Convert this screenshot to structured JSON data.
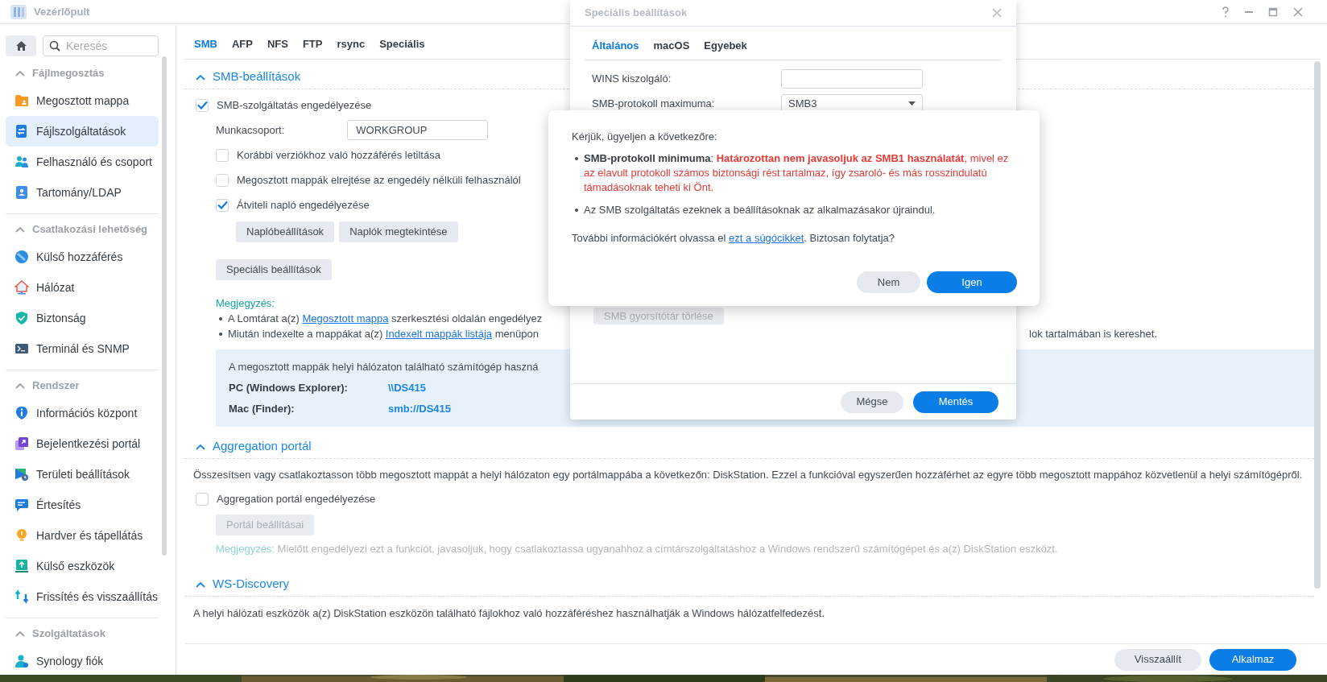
{
  "window": {
    "title": "Vezérlőpult"
  },
  "sidebar": {
    "search": {
      "placeholder": "Keresés"
    },
    "groups": [
      {
        "title": "Fájlmegosztás",
        "expanded": true,
        "items": [
          {
            "label": "Megosztott mappa",
            "selected": false
          },
          {
            "label": "Fájlszolgáltatások",
            "selected": true
          },
          {
            "label": "Felhasználó és csoport",
            "selected": false
          },
          {
            "label": "Tartomány/LDAP",
            "selected": false
          }
        ]
      },
      {
        "title": "Csatlakozási lehetőség",
        "expanded": true,
        "items": [
          {
            "label": "Külső hozzáférés",
            "selected": false
          },
          {
            "label": "Hálózat",
            "selected": false
          },
          {
            "label": "Biztonság",
            "selected": false
          },
          {
            "label": "Terminál és SNMP",
            "selected": false
          }
        ]
      },
      {
        "title": "Rendszer",
        "expanded": true,
        "items": [
          {
            "label": "Információs központ",
            "selected": false
          },
          {
            "label": "Bejelentkezési portál",
            "selected": false
          },
          {
            "label": "Területi beállítások",
            "selected": false
          },
          {
            "label": "Értesítés",
            "selected": false
          },
          {
            "label": "Hardver és tápellátás",
            "selected": false
          },
          {
            "label": "Külső eszközök",
            "selected": false
          },
          {
            "label": "Frissítés és visszaállítás",
            "selected": false
          }
        ]
      },
      {
        "title": "Szolgáltatások",
        "expanded": true,
        "items": [
          {
            "label": "Synology fiók",
            "selected": false
          }
        ]
      }
    ]
  },
  "tabs": [
    {
      "label": "SMB",
      "selected": true
    },
    {
      "label": "AFP",
      "selected": false
    },
    {
      "label": "NFS",
      "selected": false
    },
    {
      "label": "FTP",
      "selected": false
    },
    {
      "label": "rsync",
      "selected": false
    },
    {
      "label": "Speciális",
      "selected": false
    }
  ],
  "smb_section": {
    "title": "SMB-beállítások",
    "expanded": true,
    "enable": {
      "label": "SMB-szolgáltatás engedélyezése",
      "checked": true
    },
    "workgroup": {
      "label": "Munkacsoport:",
      "value": "WORKGROUP"
    },
    "options": [
      {
        "label": "Korábbi verziókhoz való hozzáférés letiltása",
        "checked": false
      },
      {
        "label": "Megosztott mappák elrejtése az engedély nélküli felhasználól",
        "checked": false
      },
      {
        "label": "Átviteli napló engedélyezése",
        "checked": true
      }
    ],
    "log_buttons": [
      {
        "label": "Naplóbeállítások",
        "disabled": false
      },
      {
        "label": "Naplók megtekintése",
        "disabled": false
      }
    ],
    "advanced_button": {
      "label": "Speciális beállítások",
      "disabled": false
    },
    "note": {
      "title": "Megjegyzés:",
      "items": [
        {
          "parts": [
            {
              "text": "A Lomtárat a(z) ",
              "link": false
            },
            {
              "text": "Megosztott mappa",
              "link": true
            },
            {
              "text": " szerkesztési oldalán engedélyez",
              "link": false
            }
          ]
        },
        {
          "parts": [
            {
              "text": "Miután indexelte a mappákat a(z) ",
              "link": false
            },
            {
              "text": "Indexelt mappák listája",
              "link": true
            },
            {
              "text": " menüpon",
              "link": false
            }
          ],
          "tail": "lok tartalmában is kereshet."
        }
      ]
    },
    "access_box": {
      "intro": "A megosztott mappák helyi hálózaton található számítógép haszná",
      "rows": [
        {
          "label": "PC (Windows Explorer):",
          "value": "\\\\DS415"
        },
        {
          "label": "Mac (Finder):",
          "value": "smb://DS415"
        }
      ]
    }
  },
  "aggregation_section": {
    "title": "Aggregation portál",
    "expanded": true,
    "description": "Összesítsen vagy csatlakoztasson több megosztott mappát a helyi hálózaton egy portálmappába a következőn: DiskStation. Ezzel a funkcióval egyszerűen hozzáférhet az egyre több megosztott mappához közvetlenül a helyi számítógépről.",
    "enable": {
      "label": "Aggregation portál engedélyezése",
      "checked": false
    },
    "settings_button": {
      "label": "Portál beállításai",
      "disabled": true
    },
    "note": {
      "title": "Megjegyzés:",
      "text": "Mielőtt engedélyezi ezt a funkciót, javasoljuk, hogy csatlakoztassa ugyanahhoz a címtárszolgáltatáshoz a Windows rendszerű számítógépet és a(z) DiskStation eszközt.",
      "disabled": true
    }
  },
  "ws_section": {
    "title": "WS-Discovery",
    "expanded": true,
    "description": "A helyi hálózati eszközök a(z) DiskStation eszközön található fájlokhoz való hozzáféréshez használhatják a Windows hálózatfelfedezést."
  },
  "footer_buttons": [
    {
      "label": "Visszaállít",
      "kind": "secondary"
    },
    {
      "label": "Alkalmaz",
      "kind": "primary"
    }
  ],
  "advanced_dialog": {
    "title": "Speciális beállítások",
    "tabs": [
      {
        "label": "Általános",
        "selected": true
      },
      {
        "label": "macOS",
        "selected": false
      },
      {
        "label": "Egyebek",
        "selected": false
      }
    ],
    "fields": [
      {
        "label": "WINS kiszolgáló:",
        "kind": "text"
      },
      {
        "label": "SMB-protokoll maximuma:",
        "kind": "select",
        "value": "SMB3"
      }
    ],
    "clear_cache_button": {
      "label": "SMB gyorsítótár törlése",
      "disabled": true
    },
    "buttons": [
      {
        "label": "Mégse",
        "kind": "secondary"
      },
      {
        "label": "Mentés",
        "kind": "primary"
      }
    ]
  },
  "confirm_dialog": {
    "heading": "Kérjük, ügyeljen a következőre:",
    "items": [
      {
        "segments": [
          {
            "text": "SMB-protokoll minimuma",
            "kind": "term"
          },
          {
            "text": ": ",
            "kind": "text"
          },
          {
            "text": "Határozottan nem javasoljuk az SMB1 használatát",
            "kind": "alert"
          },
          {
            "text": ", mivel ez az elavult protokoll számos biztonsági rést tartalmaz, így zsaroló- és más rosszindulatú támadásoknak teheti ki Önt.",
            "kind": "warning"
          }
        ]
      },
      {
        "segments": [
          {
            "text": "Az SMB szolgáltatás ezeknek a beállításoknak az alkalmazásakor újraindul.",
            "kind": "text"
          }
        ]
      }
    ],
    "footer": {
      "parts": [
        {
          "text": "További információkért olvassa el ",
          "link": false
        },
        {
          "text": "ezt a súgócikket",
          "link": true
        },
        {
          "text": ". Biztosan folytatja?",
          "link": false
        }
      ]
    },
    "buttons": [
      {
        "label": "Nem",
        "kind": "secondary"
      },
      {
        "label": "Igen",
        "kind": "primary"
      }
    ]
  }
}
